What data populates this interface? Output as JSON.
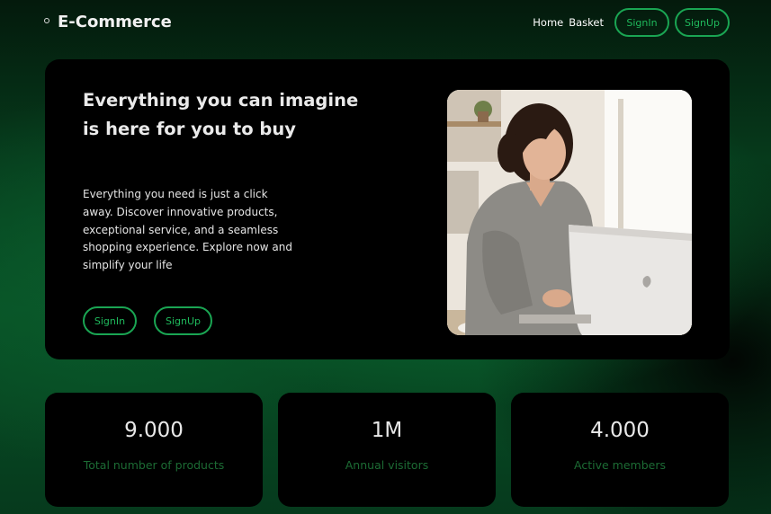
{
  "nav": {
    "brand": "E-Commerce",
    "links": [
      "Home",
      "Basket"
    ],
    "signin_label": "SignIn",
    "signup_label": "SignUp"
  },
  "hero": {
    "title": "Everything you can imagine is here for you to buy",
    "description": "Everything you need is just a click away. Discover innovative products, exceptional service, and a seamless shopping experience. Explore now and simplify your life",
    "signin_label": "SignIn",
    "signup_label": "SignUp"
  },
  "stats": [
    {
      "value": "9.000",
      "label": "Total number of products"
    },
    {
      "value": "1M",
      "label": "Annual visitors"
    },
    {
      "value": "4.000",
      "label": "Active members"
    }
  ],
  "colors": {
    "accent": "#1aa553",
    "stat_label": "#1c6b34",
    "card_bg": "#000000"
  },
  "icons": {
    "brand_dot": "circle-icon"
  }
}
